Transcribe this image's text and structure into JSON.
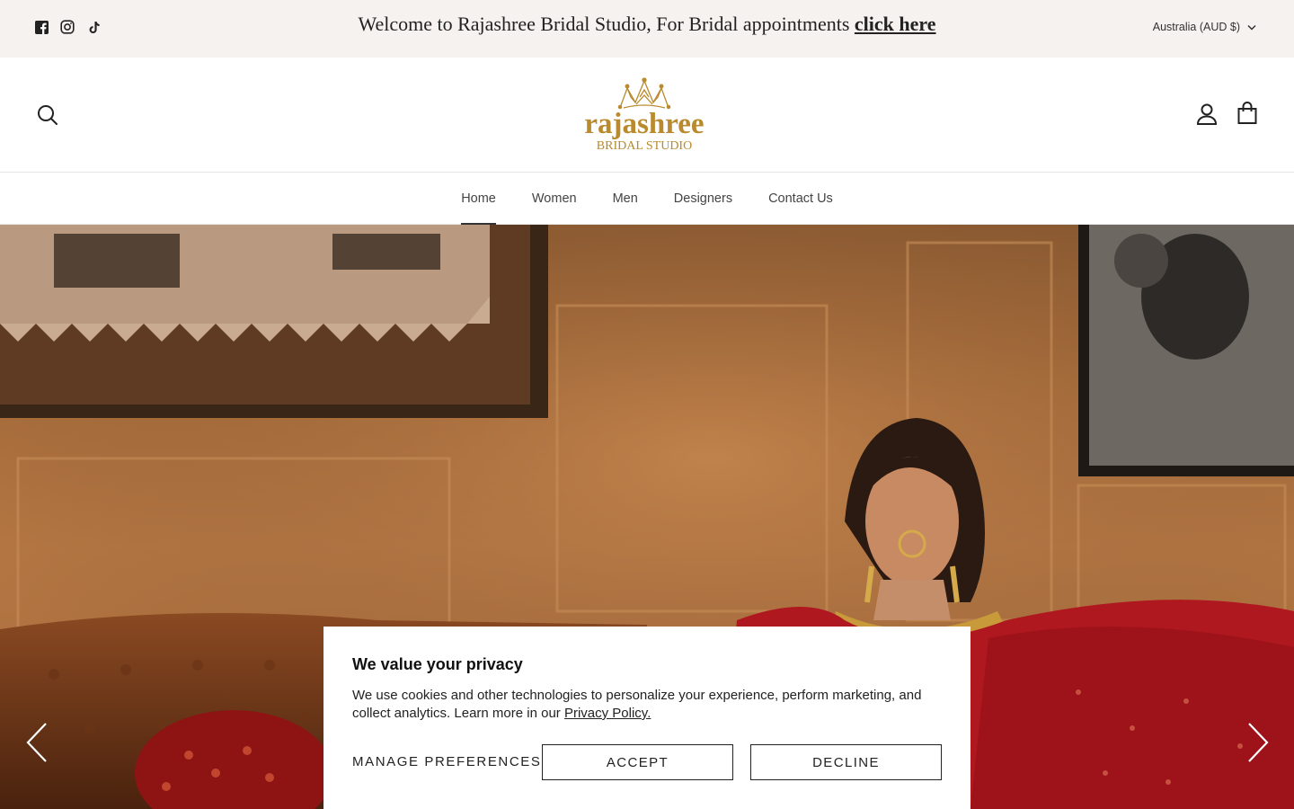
{
  "announcement": {
    "text": "Welcome to Rajashree Bridal Studio, For Bridal appointments ",
    "link_label": "click here",
    "locale": "Australia (AUD $)"
  },
  "social": [
    "facebook-icon",
    "instagram-icon",
    "tiktok-icon"
  ],
  "header": {
    "logo_wordmark": "rajashree",
    "logo_subtitle": "BRIDAL STUDIO",
    "brand_color": "#b98a2e"
  },
  "nav": {
    "items": [
      {
        "label": "Home",
        "active": true
      },
      {
        "label": "Women",
        "active": false
      },
      {
        "label": "Men",
        "active": false
      },
      {
        "label": "Designers",
        "active": false
      },
      {
        "label": "Contact Us",
        "active": false
      }
    ]
  },
  "cookie": {
    "title": "We value your privacy",
    "body": "We use cookies and other technologies to personalize your experience, perform marketing, and collect analytics. Learn more in our ",
    "policy_link": "Privacy Policy.",
    "manage_label": "MANAGE PREFERENCES",
    "accept_label": "ACCEPT",
    "decline_label": "DECLINE"
  }
}
